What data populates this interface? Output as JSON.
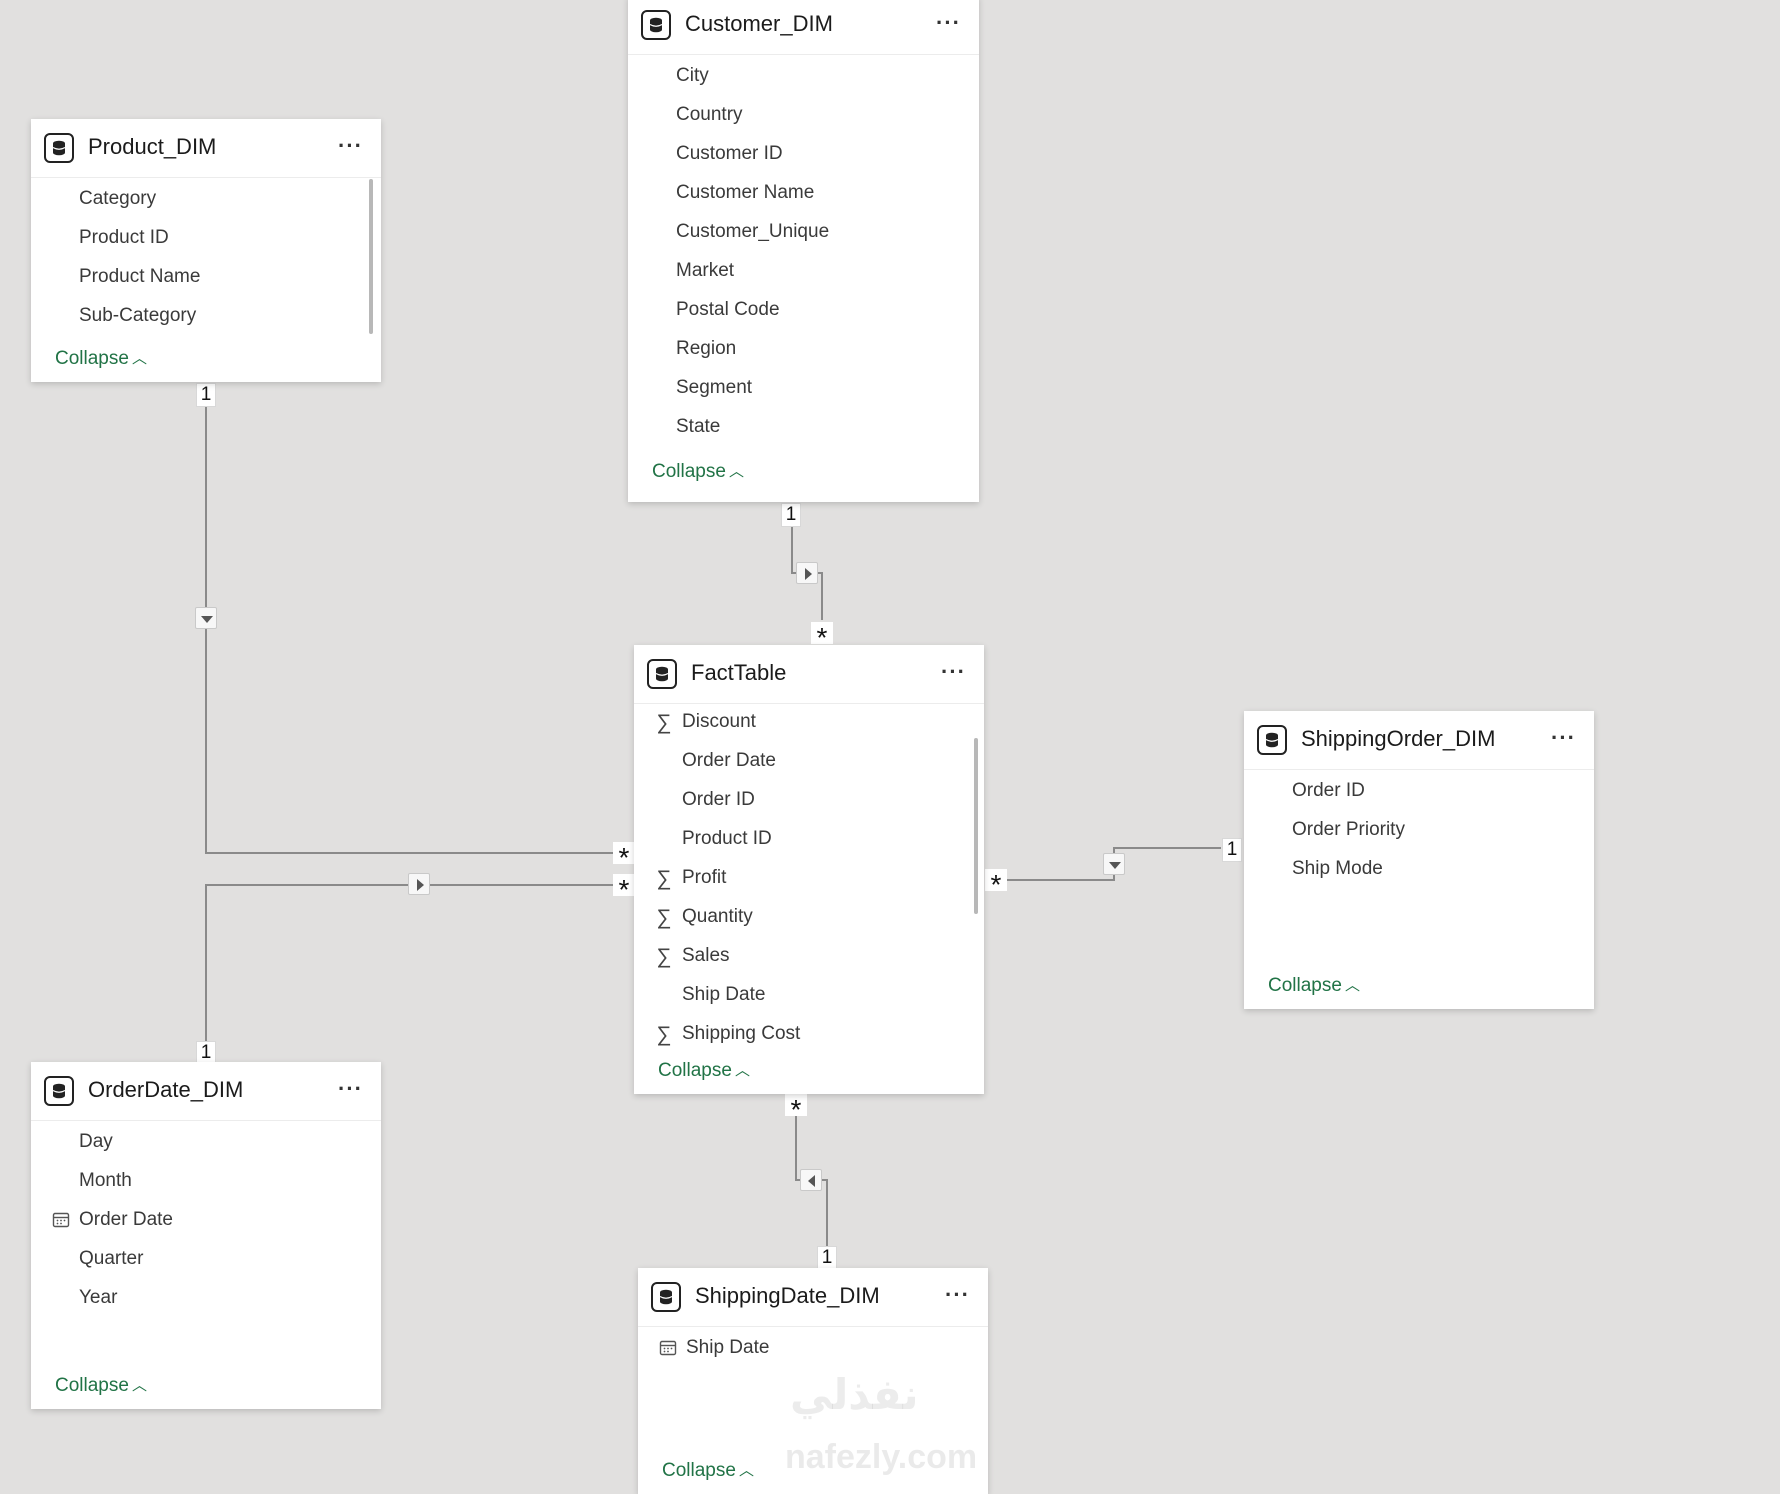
{
  "tables": [
    {
      "name": "Product_DIM",
      "fields": [
        {
          "label": "Category",
          "icon": ""
        },
        {
          "label": "Product ID",
          "icon": ""
        },
        {
          "label": "Product Name",
          "icon": ""
        },
        {
          "label": "Sub-Category",
          "icon": ""
        }
      ],
      "collapse_label": "Collapse"
    },
    {
      "name": "Customer_DIM",
      "fields": [
        {
          "label": "City",
          "icon": ""
        },
        {
          "label": "Country",
          "icon": ""
        },
        {
          "label": "Customer ID",
          "icon": ""
        },
        {
          "label": "Customer Name",
          "icon": ""
        },
        {
          "label": "Customer_Unique",
          "icon": ""
        },
        {
          "label": "Market",
          "icon": ""
        },
        {
          "label": "Postal Code",
          "icon": ""
        },
        {
          "label": "Region",
          "icon": ""
        },
        {
          "label": "Segment",
          "icon": ""
        },
        {
          "label": "State",
          "icon": ""
        }
      ],
      "collapse_label": "Collapse"
    },
    {
      "name": "FactTable",
      "fields": [
        {
          "label": "Discount",
          "icon": "sigma"
        },
        {
          "label": "Order Date",
          "icon": ""
        },
        {
          "label": "Order ID",
          "icon": ""
        },
        {
          "label": "Product ID",
          "icon": ""
        },
        {
          "label": "Profit",
          "icon": "sigma"
        },
        {
          "label": "Quantity",
          "icon": "sigma"
        },
        {
          "label": "Sales",
          "icon": "sigma"
        },
        {
          "label": "Ship Date",
          "icon": ""
        },
        {
          "label": "Shipping Cost",
          "icon": "sigma"
        }
      ],
      "collapse_label": "Collapse"
    },
    {
      "name": "ShippingOrder_DIM",
      "fields": [
        {
          "label": "Order ID",
          "icon": ""
        },
        {
          "label": "Order Priority",
          "icon": ""
        },
        {
          "label": "Ship Mode",
          "icon": ""
        }
      ],
      "collapse_label": "Collapse"
    },
    {
      "name": "OrderDate_DIM",
      "fields": [
        {
          "label": "Day",
          "icon": ""
        },
        {
          "label": "Month",
          "icon": ""
        },
        {
          "label": "Order Date",
          "icon": "calendar"
        },
        {
          "label": "Quarter",
          "icon": ""
        },
        {
          "label": "Year",
          "icon": ""
        }
      ],
      "collapse_label": "Collapse"
    },
    {
      "name": "ShippingDate_DIM",
      "fields": [
        {
          "label": "Ship Date",
          "icon": "calendar"
        }
      ],
      "collapse_label": "Collapse"
    }
  ],
  "relationships": [
    {
      "from": "Product_DIM",
      "to": "FactTable",
      "from_card": "1",
      "to_card": "*"
    },
    {
      "from": "Customer_DIM",
      "to": "FactTable",
      "from_card": "1",
      "to_card": "*"
    },
    {
      "from": "OrderDate_DIM",
      "to": "FactTable",
      "from_card": "1",
      "to_card": "*"
    },
    {
      "from": "ShippingOrder_DIM",
      "to": "FactTable",
      "from_card": "1",
      "to_card": "*"
    },
    {
      "from": "ShippingDate_DIM",
      "to": "FactTable",
      "from_card": "1",
      "to_card": "*"
    }
  ],
  "colors": {
    "background": "#e1e0df",
    "collapse_link": "#217346",
    "line": "#8a8a8a"
  },
  "watermark": {
    "arabic": "نفذلي",
    "latin": "nafezly.com"
  }
}
